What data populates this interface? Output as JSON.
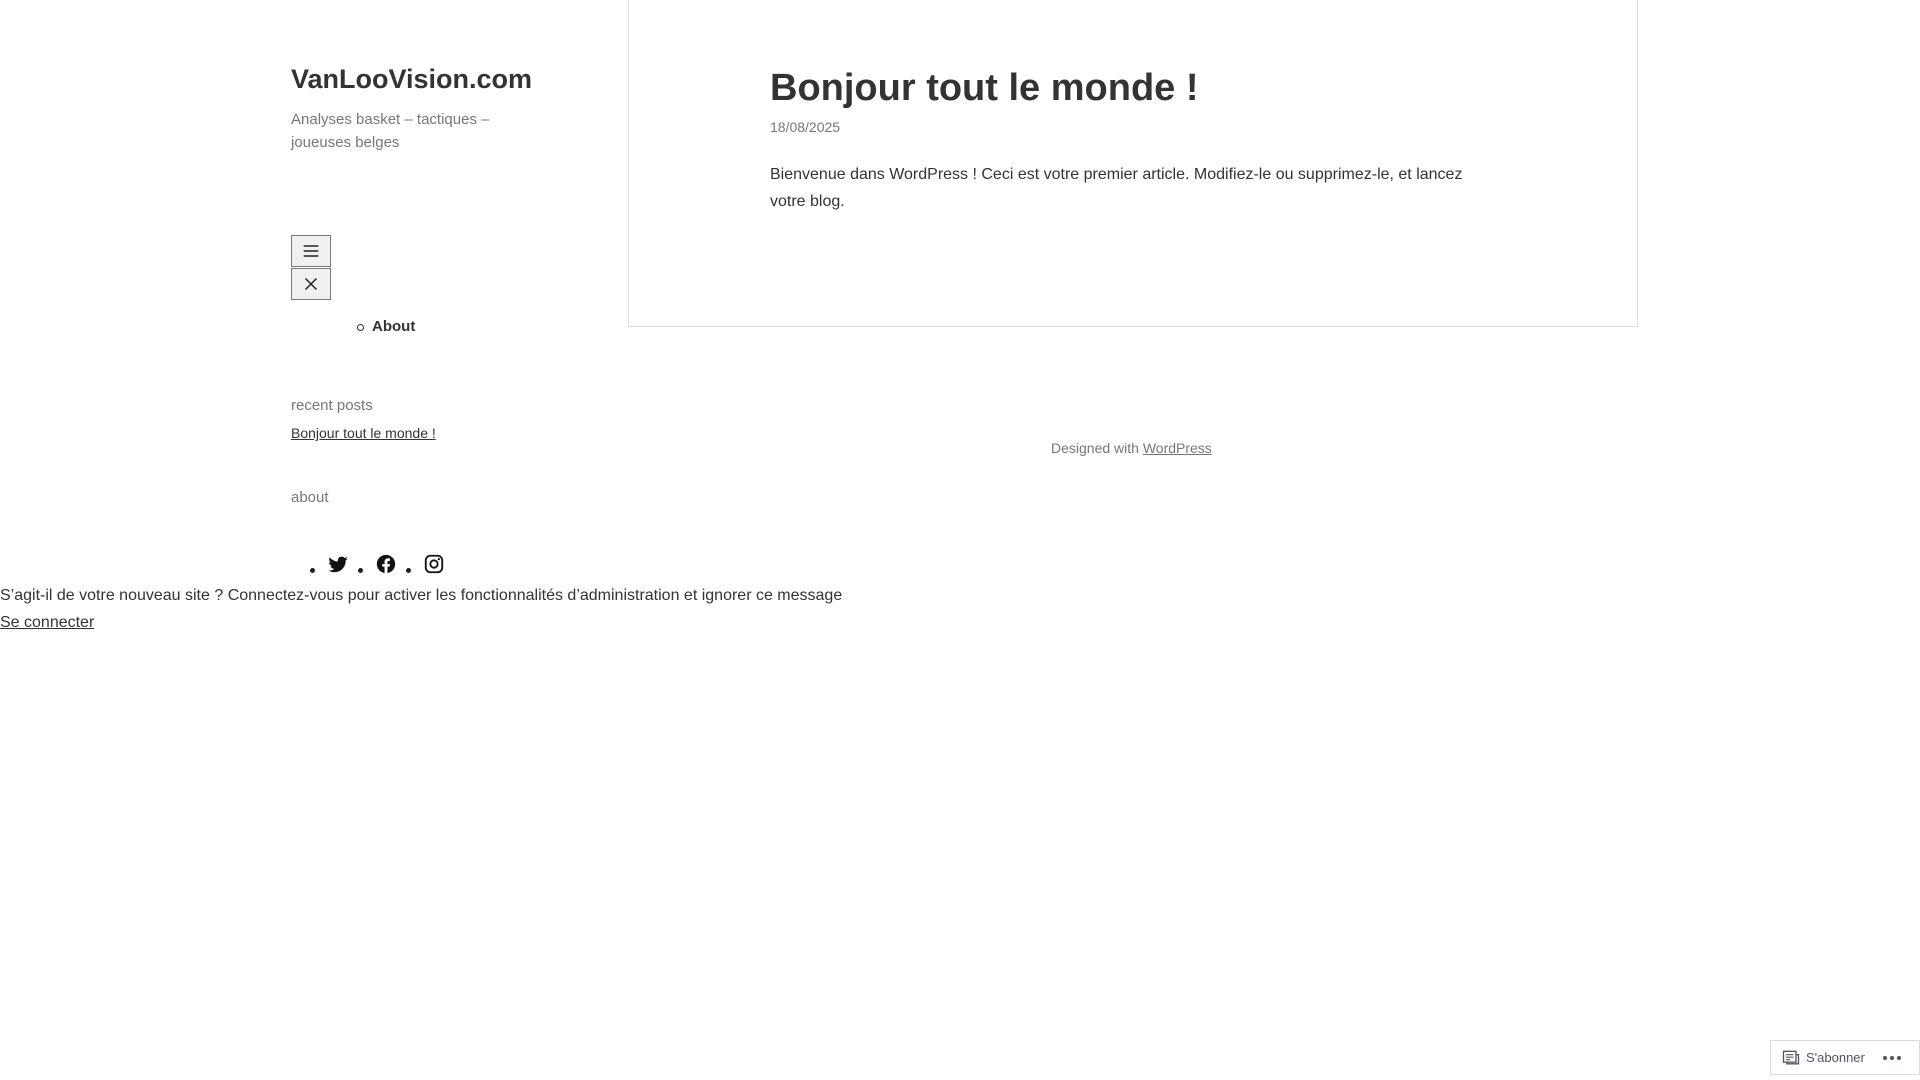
{
  "site": {
    "title": "VanLooVision.com",
    "tagline": "Analyses basket – tactiques – joueuses belges"
  },
  "menu": {
    "open_icon": "hamburger-icon",
    "close_icon": "close-icon",
    "items": [
      {
        "label": "About"
      }
    ]
  },
  "widgets": {
    "recent_title": "recent posts",
    "recent_posts": [
      {
        "label": "Bonjour tout le monde !"
      }
    ],
    "about_title": "about",
    "social_icons": [
      "twitter-icon",
      "facebook-icon",
      "instagram-icon"
    ]
  },
  "post": {
    "title": "Bonjour tout le monde !",
    "date": "18/08/2025",
    "content": "Bienvenue dans WordPress ! Ceci est votre premier article. Modifiez-le ou supprimez-le, et lancez votre blog."
  },
  "footer": {
    "prefix": "Designed with",
    "link": "WordPress"
  },
  "admin_notice": {
    "text": "S’agit-il de votre nouveau site ? Connectez-vous pour activer les fonctionnalités d’administration et ignorer ce message",
    "login": "Se connecter"
  },
  "subscribe": {
    "label": "S'abonner",
    "icon": "reader-icon",
    "more_icon": "ellipsis-icon"
  }
}
